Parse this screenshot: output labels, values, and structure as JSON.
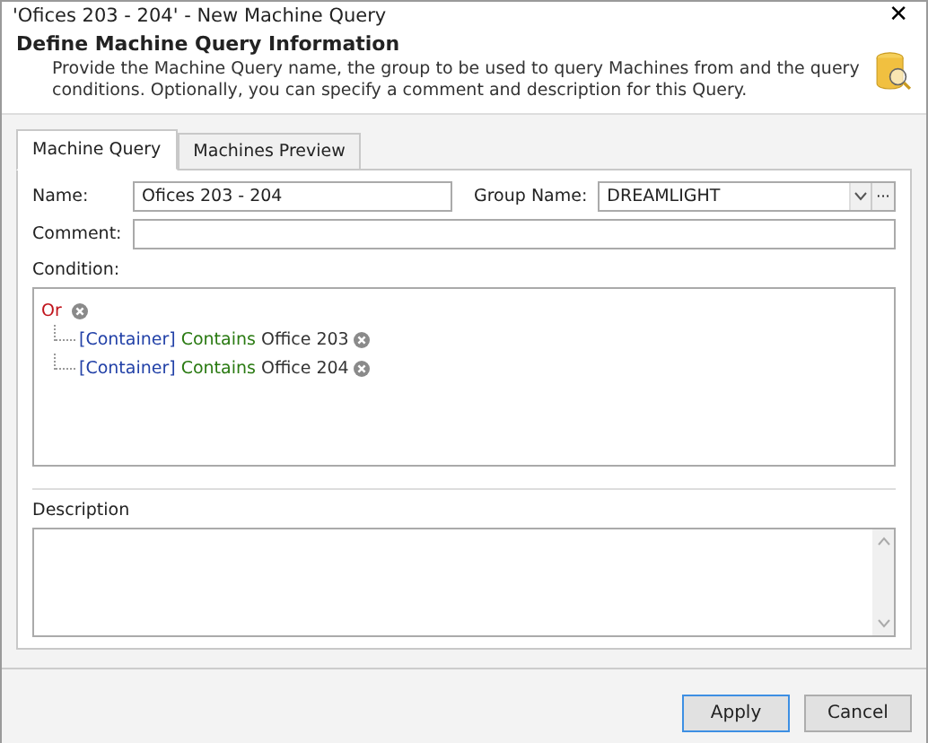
{
  "window": {
    "title": "'Ofices 203 - 204' - New Machine Query",
    "close": "✕"
  },
  "header": {
    "title": "Define Machine Query Information",
    "description": "Provide the Machine Query name, the group to be used to query Machines from and the query conditions. Optionally, you can specify a comment and description for this Query."
  },
  "tabs": [
    {
      "label": "Machine Query",
      "selected": true
    },
    {
      "label": "Machines Preview",
      "selected": false
    }
  ],
  "form": {
    "name_label": "Name:",
    "name_value": "Ofices 203 - 204",
    "group_label": "Group Name:",
    "group_value": "DREAMLIGHT",
    "group_more": "···",
    "comment_label": "Comment:",
    "condition_label": "Condition:",
    "description_label": "Description"
  },
  "condition": {
    "operator": "Or",
    "children": [
      {
        "field": "[Container]",
        "op": "Contains",
        "value": "Office 203"
      },
      {
        "field": "[Container]",
        "op": "Contains",
        "value": "Office 204"
      }
    ]
  },
  "buttons": [
    {
      "label": "Apply",
      "selected": true
    },
    {
      "label": "Cancel",
      "selected": false
    }
  ]
}
